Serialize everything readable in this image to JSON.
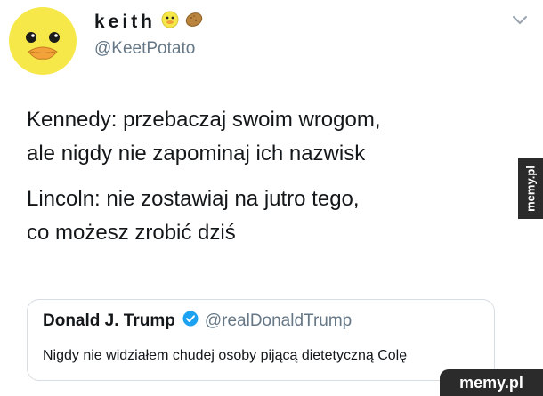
{
  "tweet": {
    "display_name": "keith",
    "name_emojis": [
      "duck-face-icon",
      "potato-icon"
    ],
    "handle": "@KeetPotato",
    "text_paragraphs": [
      [
        "Kennedy: przebaczaj swoim wrogom,",
        "ale nigdy nie zapominaj ich nazwisk"
      ],
      [
        "Lincoln: nie zostawiaj na jutro tego,",
        "co możesz zrobić dziś"
      ]
    ],
    "menu_icon": "chevron-down-icon"
  },
  "quote": {
    "name": "Donald J. Trump",
    "verified_icon": "verified-badge-icon",
    "handle": "@realDonaldTrump",
    "text": "Nigdy nie widziałem chudej osoby pijącą dietetyczną Colę"
  },
  "watermarks": {
    "side": "memy.pl",
    "corner": "memy.pl"
  },
  "colors": {
    "text": "#14171a",
    "secondary_text": "#657786",
    "border": "#d8dde1",
    "verified": "#1da1f2",
    "avatar_yellow": "#f7e84a",
    "watermark_bg": "#2b2b2b"
  }
}
